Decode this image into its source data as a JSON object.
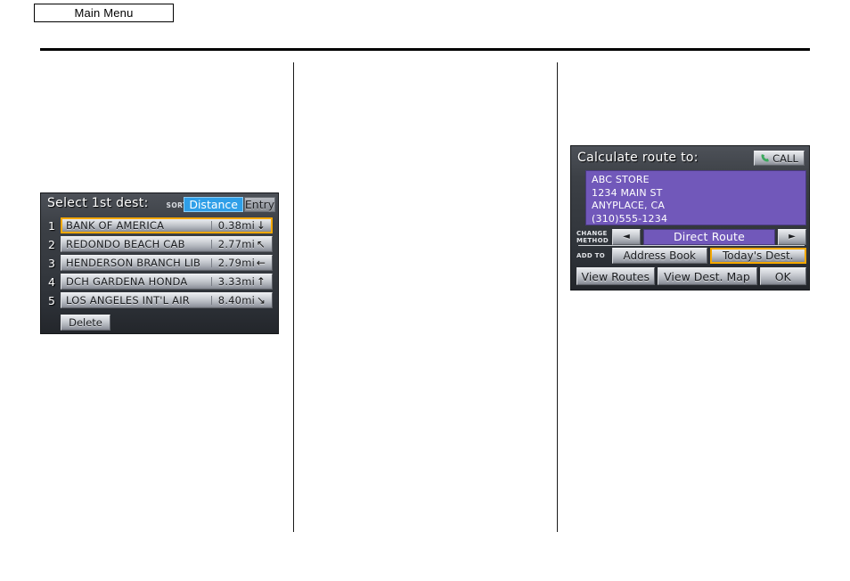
{
  "page": {
    "main_menu_label": "Main Menu"
  },
  "select_dest_screen": {
    "title": "Select 1st dest:",
    "sort_by_label": "SORT BY",
    "sort_tabs": [
      {
        "label": "Distance",
        "selected": true
      },
      {
        "label": "Entry",
        "selected": false
      }
    ],
    "rows": [
      {
        "num": "1",
        "name": "BANK OF AMERICA",
        "distance": "0.38mi",
        "arrow": "arrow-down-icon",
        "glyph": "↓",
        "highlighted": true
      },
      {
        "num": "2",
        "name": "REDONDO BEACH CAB",
        "distance": "2.77mi",
        "arrow": "arrow-up-left-icon",
        "glyph": "↖",
        "highlighted": false
      },
      {
        "num": "3",
        "name": "HENDERSON BRANCH LIB",
        "distance": "2.79mi",
        "arrow": "arrow-left-icon",
        "glyph": "←",
        "highlighted": false
      },
      {
        "num": "4",
        "name": "DCH GARDENA HONDA",
        "distance": "3.33mi",
        "arrow": "arrow-up-icon",
        "glyph": "↑",
        "highlighted": false
      },
      {
        "num": "5",
        "name": "LOS ANGELES INT'L AIR",
        "distance": "8.40mi",
        "arrow": "arrow-down-right-icon",
        "glyph": "↘",
        "highlighted": false
      }
    ],
    "delete_label": "Delete"
  },
  "calculate_route_screen": {
    "title": "Calculate route to:",
    "call_label": "CALL",
    "call_icon": "phone-handset-icon",
    "destination": {
      "name": "ABC STORE",
      "street": "1234 MAIN ST",
      "city_state": "ANYPLACE, CA",
      "phone": "(310)555-1234"
    },
    "change_method": {
      "label_line1": "CHANGE",
      "label_line2": "METHOD",
      "prev_glyph": "◄",
      "next_glyph": "►",
      "value": "Direct Route"
    },
    "add_to": {
      "label": "ADD TO",
      "buttons": [
        {
          "label": "Address Book",
          "highlighted": false
        },
        {
          "label": "Today's Dest.",
          "highlighted": true
        }
      ]
    },
    "bottom_buttons": [
      {
        "label": "View Routes"
      },
      {
        "label": "View Dest. Map"
      },
      {
        "label": "OK"
      }
    ]
  },
  "colors": {
    "accent_highlight": "#f5a800",
    "tab_selected": "#2f9fe8",
    "panel_purple": "#7158ba",
    "call_icon_green": "#3aa85c"
  }
}
